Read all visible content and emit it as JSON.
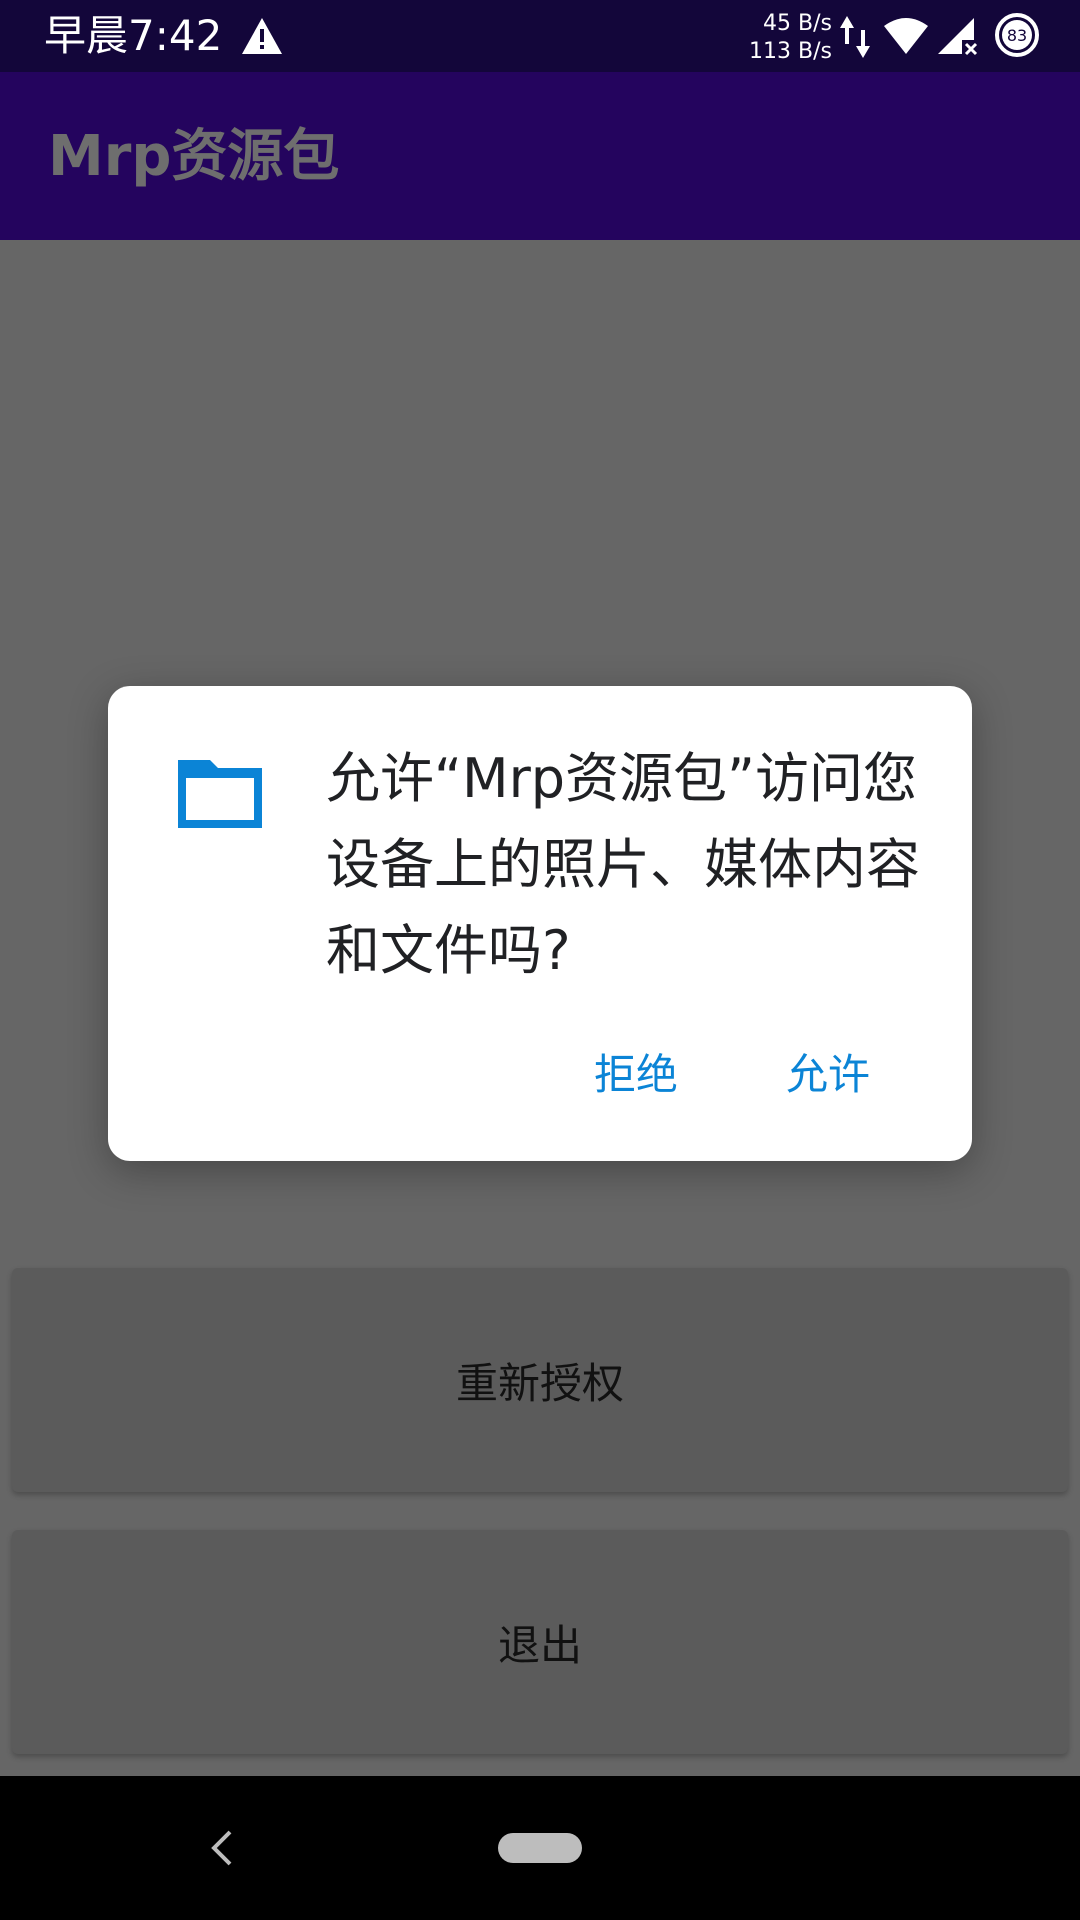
{
  "status_bar": {
    "time": "早晨7:42",
    "net_up": "45 B/s",
    "net_down": "113 B/s",
    "battery_level": "83",
    "icons": [
      "warning-icon",
      "data-updown-icon",
      "wifi-icon",
      "signal-no-sim-icon",
      "battery-icon"
    ]
  },
  "app_bar": {
    "title": "Mrp资源包"
  },
  "dialog": {
    "icon": "folder-icon",
    "message": "允许“Mrp资源包”访问您设备上的照片、媒体内容和文件吗?",
    "deny_label": "拒绝",
    "allow_label": "允许"
  },
  "buttons": {
    "reauthorize_label": "重新授权",
    "exit_label": "退出"
  },
  "nav_bar": {
    "icons": [
      "back-icon",
      "home-pill-icon"
    ]
  },
  "colors": {
    "status_bar": "#13063a",
    "app_bar_dimmed": "#24045e",
    "accent": "#0b84d6",
    "scrim": "#666666"
  }
}
